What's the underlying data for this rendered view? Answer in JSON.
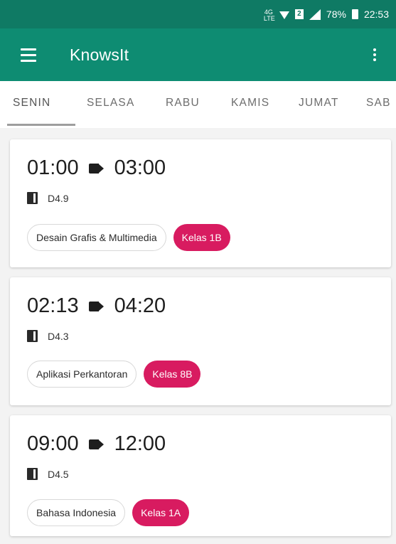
{
  "status_bar": {
    "network_label": "4G LTE",
    "sim_label": "2",
    "battery_percent": "78%",
    "time": "22:53"
  },
  "app_bar": {
    "title": "KnowsIt",
    "menu_icon": "hamburger-menu-icon",
    "overflow_icon": "more-vert-icon"
  },
  "tabs": [
    {
      "label": "SENIN",
      "active": true
    },
    {
      "label": "SELASA",
      "active": false
    },
    {
      "label": "RABU",
      "active": false
    },
    {
      "label": "KAMIS",
      "active": false
    },
    {
      "label": "JUMAT",
      "active": false
    },
    {
      "label": "SAB",
      "active": false
    }
  ],
  "schedule": [
    {
      "start": "01:00",
      "end": "03:00",
      "room": "D4.9",
      "subject": "Desain Grafis & Multimedia",
      "class": "Kelas 1B"
    },
    {
      "start": "02:13",
      "end": "04:20",
      "room": "D4.3",
      "subject": "Aplikasi Perkantoran",
      "class": "Kelas 8B"
    },
    {
      "start": "09:00",
      "end": "12:00",
      "room": "D4.5",
      "subject": "Bahasa Indonesia",
      "class": "Kelas 1A"
    }
  ],
  "colors": {
    "status_bar": "#0f7a64",
    "app_bar": "#0e8c72",
    "class_chip": "#d81b60",
    "background": "#f3f3f3"
  }
}
